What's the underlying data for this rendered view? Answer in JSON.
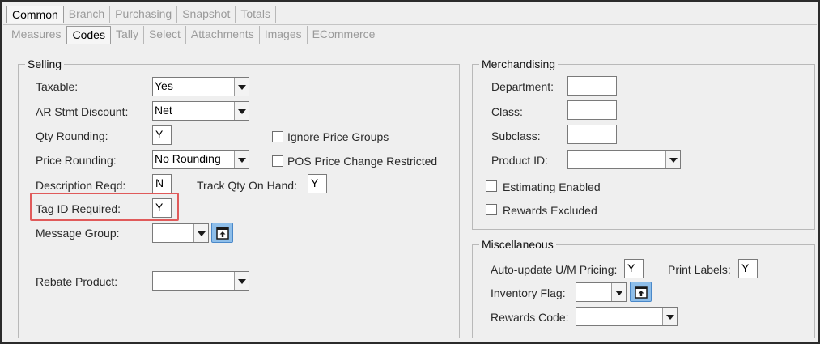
{
  "tabs_row1": [
    "Common",
    "Branch",
    "Purchasing",
    "Snapshot",
    "Totals"
  ],
  "tabs_row2": [
    "Measures",
    "Codes",
    "Tally",
    "Select",
    "Attachments",
    "Images",
    "ECommerce"
  ],
  "active_tab_row1": "Common",
  "active_tab_row2": "Codes",
  "selling": {
    "legend": "Selling",
    "taxable_label": "Taxable:",
    "taxable_value": "Yes",
    "ar_stmt_label": "AR Stmt Discount:",
    "ar_stmt_value": "Net",
    "qty_rounding_label": "Qty Rounding:",
    "qty_rounding_value": "Y",
    "price_rounding_label": "Price Rounding:",
    "price_rounding_value": "No Rounding",
    "ignore_price_groups_label": "Ignore Price Groups",
    "pos_price_change_label": "POS Price Change Restricted",
    "description_reqd_label": "Description Reqd:",
    "description_reqd_value": "N",
    "track_qty_label": "Track Qty On Hand:",
    "track_qty_value": "Y",
    "tag_id_label": "Tag ID Required:",
    "tag_id_value": "Y",
    "message_group_label": "Message Group:",
    "message_group_value": "",
    "rebate_product_label": "Rebate Product:",
    "rebate_product_value": ""
  },
  "merchandising": {
    "legend": "Merchandising",
    "department_label": "Department:",
    "department_value": "",
    "class_label": "Class:",
    "class_value": "",
    "subclass_label": "Subclass:",
    "subclass_value": "",
    "product_id_label": "Product ID:",
    "product_id_value": "",
    "estimating_enabled_label": "Estimating Enabled",
    "rewards_excluded_label": "Rewards Excluded"
  },
  "miscellaneous": {
    "legend": "Miscellaneous",
    "auto_update_label": "Auto-update U/M Pricing:",
    "auto_update_value": "Y",
    "print_labels_label": "Print Labels:",
    "print_labels_value": "Y",
    "inventory_flag_label": "Inventory Flag:",
    "inventory_flag_value": "",
    "rewards_code_label": "Rewards Code:",
    "rewards_code_value": ""
  },
  "colors": {
    "highlight": "#e05a5a",
    "lookup_button": "#8ebee9",
    "disabled_tab_text": "#9a9a9a"
  }
}
